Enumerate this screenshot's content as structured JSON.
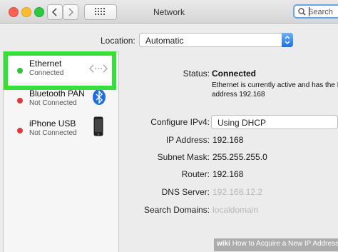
{
  "window": {
    "title": "Network"
  },
  "search": {
    "placeholder": "Search"
  },
  "location": {
    "label": "Location:",
    "value": "Automatic"
  },
  "services": [
    {
      "name": "Ethernet",
      "status": "Connected",
      "status_color": "#31c13a",
      "icon": "ethernet-arrows-icon"
    },
    {
      "name": "Bluetooth PAN",
      "status": "Not Connected",
      "status_color": "#dd3b3b",
      "icon": "bluetooth-icon"
    },
    {
      "name": "iPhone USB",
      "status": "Not Connected",
      "status_color": "#dd3b3b",
      "icon": "iphone-icon"
    }
  ],
  "main": {
    "status_label": "Status:",
    "status_value": "Connected",
    "status_desc_line1": "Ethernet is currently active and has the I",
    "status_desc_line2": "address 192.168",
    "configure_label": "Configure IPv4:",
    "configure_value": "Using DHCP",
    "ip_label": "IP Address:",
    "ip_value": "192.168",
    "subnet_label": "Subnet Mask:",
    "subnet_value": "255.255.255.0",
    "router_label": "Router:",
    "router_value": "192.168",
    "dns_label": "DNS Server:",
    "dns_value": "192.168.12.2",
    "domains_label": "Search Domains:",
    "domains_value": "localdomain"
  },
  "footer": {
    "brand": "wiki",
    "text": "How to Acquire a New IP Address"
  },
  "colors": {
    "highlight": "#33e236",
    "accent": "#1e6fe0",
    "connected": "#31c13a",
    "disconnected": "#dd3b3b"
  }
}
